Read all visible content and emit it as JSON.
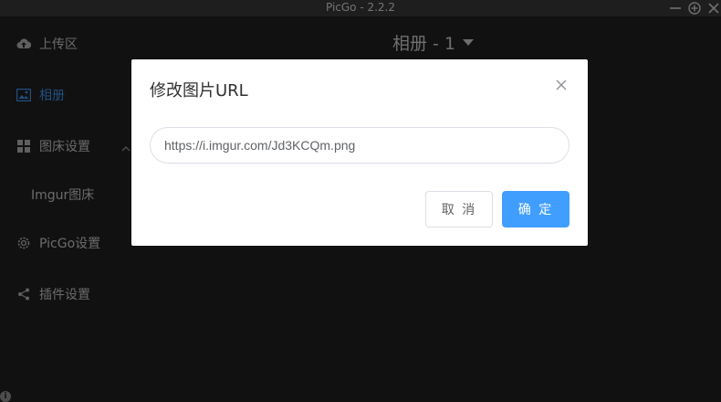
{
  "window": {
    "title": "PicGo - 2.2.2"
  },
  "sidebar": {
    "items": [
      {
        "label": "上传区",
        "icon": "upload-cloud-icon"
      },
      {
        "label": "相册",
        "icon": "image-icon",
        "active": true
      },
      {
        "label": "图床设置",
        "icon": "grid-icon",
        "expanded": true
      },
      {
        "label": "Imgur图床",
        "sub": true
      },
      {
        "label": "PicGo设置",
        "icon": "gear-icon"
      },
      {
        "label": "插件设置",
        "icon": "share-icon"
      }
    ]
  },
  "gallery": {
    "title": "相册 - 1"
  },
  "dialog": {
    "title": "修改图片URL",
    "input_value": "https://i.imgur.com/Jd3KCQm.png",
    "cancel_label": "取 消",
    "confirm_label": "确 定"
  },
  "colors": {
    "accent": "#409eff",
    "sidebar_bg": "#222222",
    "titlebar_bg": "#3c3c3c"
  }
}
